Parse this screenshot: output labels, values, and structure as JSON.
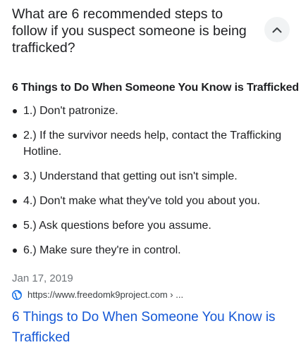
{
  "question": {
    "text": "What are 6 recommended steps to follow if you suspect someone is being trafficked?",
    "collapse_icon": "chevron-up-icon"
  },
  "snippet": {
    "heading": "6 Things to Do When Someone You Know is Trafficked",
    "steps": [
      "1.) Don't patronize.",
      "2.) If the survivor needs help, contact the Trafficking Hotline.",
      "3.) Understand that getting out isn't simple.",
      "4.) Don't make what they've told you about you.",
      "5.) Ask questions before you assume.",
      "6.) Make sure they're in control."
    ],
    "date": "Jan 17, 2019",
    "source_url": "https://www.freedomk9project.com › ...",
    "source_icon": "globe-icon",
    "link_title": "6 Things to Do When Someone You Know is Trafficked"
  },
  "colors": {
    "text": "#202124",
    "secondary_text": "#70757a",
    "link": "#1558d6",
    "button_bg": "#f1f3f4",
    "globe": "#1a73e8"
  }
}
